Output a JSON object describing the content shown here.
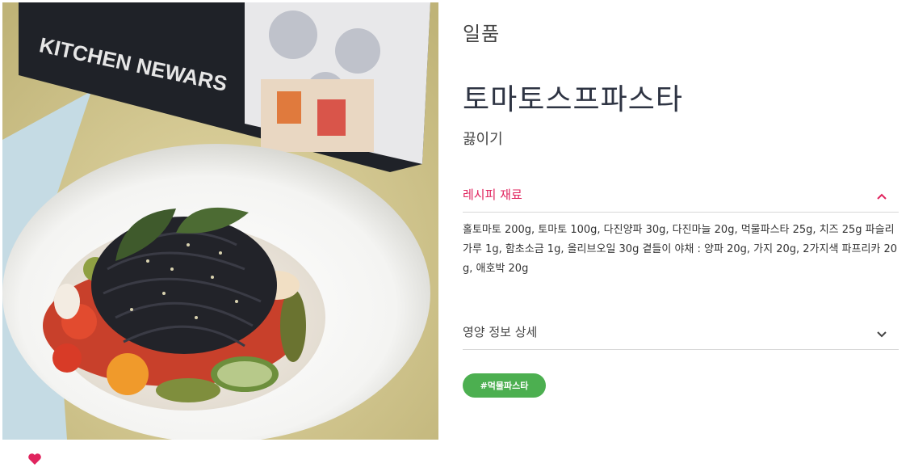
{
  "recipe": {
    "category": "일품",
    "title": "토마토스프파스타",
    "method": "끓이기",
    "ingredients_label": "레시피 재료",
    "ingredients_text": "홀토마토 200g, 토마토 100g, 다진양파 30g, 다진마늘 20g, 먹물파스타 25g, 치즈 25g 파슬리가루 1g, 함초소금 1g, 올리브오일 30g 곁들이 야채 : 양파 20g, 가지 20g, 2가지색 파프리카 20g, 애호박 20g",
    "nutrition_label": "영양 정보 상세",
    "tags": [
      "#먹물파스타"
    ]
  },
  "photo": {
    "package_text": "KITCHEN NEWARS",
    "subject": "squid ink pasta with tomato soup and vegetables in a white bowl"
  },
  "colors": {
    "accent_pink": "#e0245e",
    "tag_green": "#4caf50",
    "title": "#2e3443"
  },
  "icons": {
    "like": "heart-icon",
    "ingredients_toggle": "chevron-up-icon",
    "nutrition_toggle": "chevron-down-icon"
  }
}
